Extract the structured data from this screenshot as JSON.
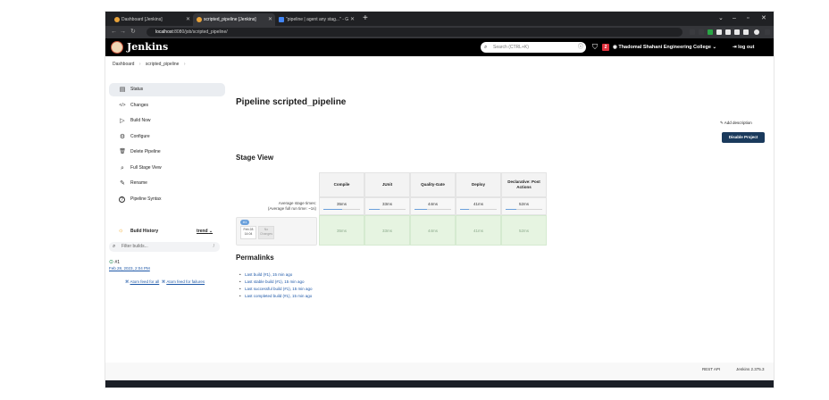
{
  "browser": {
    "tabs": [
      {
        "label": "Dashboard [Jenkins]",
        "active": false
      },
      {
        "label": "scripted_pipeline [Jenkins]",
        "active": true
      },
      {
        "label": "\"pipeline | agent any stag...\" - G",
        "active": false
      }
    ],
    "url_host": "localhost",
    "url_path": ":8080/job/scripted_pipeline/"
  },
  "header": {
    "title": "Jenkins",
    "search_placeholder": "Search (CTRL+K)",
    "notification_count": "2",
    "user": "Thadomal Shahani Engineering College",
    "logout": "log out"
  },
  "breadcrumb": [
    "Dashboard",
    "scripted_pipeline"
  ],
  "sidebar": {
    "items": [
      {
        "label": "Status",
        "icon": "clipboard-icon",
        "glyph": "▤"
      },
      {
        "label": "Changes",
        "icon": "code-icon",
        "glyph": "</>"
      },
      {
        "label": "Build Now",
        "icon": "play-icon",
        "glyph": "▷"
      },
      {
        "label": "Configure",
        "icon": "gear-icon",
        "glyph": "⚙"
      },
      {
        "label": "Delete Pipeline",
        "icon": "trash-icon",
        "glyph": "🗑"
      },
      {
        "label": "Full Stage View",
        "icon": "search-icon",
        "glyph": "⌕"
      },
      {
        "label": "Rename",
        "icon": "pencil-icon",
        "glyph": "✎"
      },
      {
        "label": "Pipeline Syntax",
        "icon": "help-icon",
        "glyph": "?"
      }
    ],
    "build_history": {
      "title": "Build History",
      "trend": "trend",
      "filter_placeholder": "Filter builds...",
      "filter_shortcut": "/",
      "build_number": "#1",
      "build_date": "Feb 28, 2023, 2:04 PM",
      "atom_all": "Atom feed for all",
      "atom_failures": "Atom feed for failures"
    }
  },
  "main": {
    "title": "Pipeline scripted_pipeline",
    "add_description": "Add description",
    "disable_project": "Disable Project",
    "stage_view_title": "Stage View",
    "average_label_1": "Average stage times:",
    "average_label_2": "(Average full run time: ~1s)",
    "run": {
      "number": "#1",
      "date": "Feb 28",
      "time": "14:04",
      "changes": "No Changes"
    },
    "stages": [
      {
        "name": "Compile",
        "avg": "35ms",
        "cell": "35ms",
        "fill": 0.5
      },
      {
        "name": "JUnit",
        "avg": "33ms",
        "cell": "33ms",
        "fill": 0.3
      },
      {
        "name": "Quality-Gate",
        "avg": "44ms",
        "cell": "44ms",
        "fill": 0.35
      },
      {
        "name": "Deploy",
        "avg": "41ms",
        "cell": "41ms",
        "fill": 0.25
      },
      {
        "name": "Declarative: Post Actions",
        "avg": "52ms",
        "cell": "52ms",
        "fill": 0.3
      }
    ],
    "permalinks_title": "Permalinks",
    "permalinks": [
      "Last build (#1), 15 min ago",
      "Last stable build (#1), 15 min ago",
      "Last successful build (#1), 15 min ago",
      "Last completed build (#1), 15 min ago"
    ]
  },
  "footer": {
    "rest_api": "REST API",
    "version": "Jenkins 2.375.3"
  },
  "colors": {
    "header_bg": "#000000",
    "link": "#1f59a8",
    "success": "#138347",
    "primary_button": "#1a3a5c"
  }
}
